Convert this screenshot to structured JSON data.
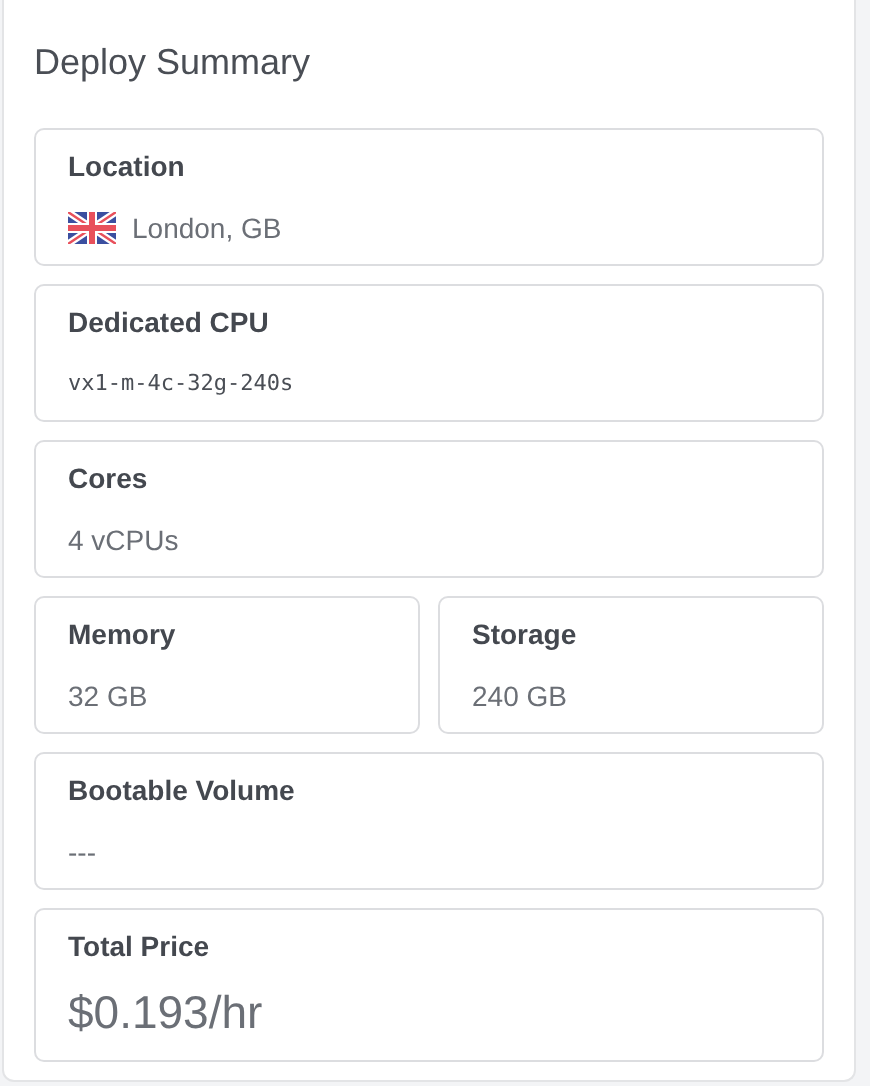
{
  "title": "Deploy Summary",
  "rows": [
    [
      {
        "label": "Location",
        "value": "London, GB",
        "kind": "location"
      }
    ],
    [
      {
        "label": "Dedicated CPU",
        "value": "vx1-m-4c-32g-240s",
        "kind": "mono"
      }
    ],
    [
      {
        "label": "Cores",
        "value": "4 vCPUs",
        "kind": "text"
      }
    ],
    [
      {
        "label": "Memory",
        "value": "32 GB",
        "kind": "text"
      },
      {
        "label": "Storage",
        "value": "240 GB",
        "kind": "text"
      }
    ],
    [
      {
        "label": "Bootable Volume",
        "value": "---",
        "kind": "text"
      }
    ],
    [
      {
        "label": "Total Price",
        "value": "$0.193/hr",
        "kind": "price"
      }
    ]
  ]
}
